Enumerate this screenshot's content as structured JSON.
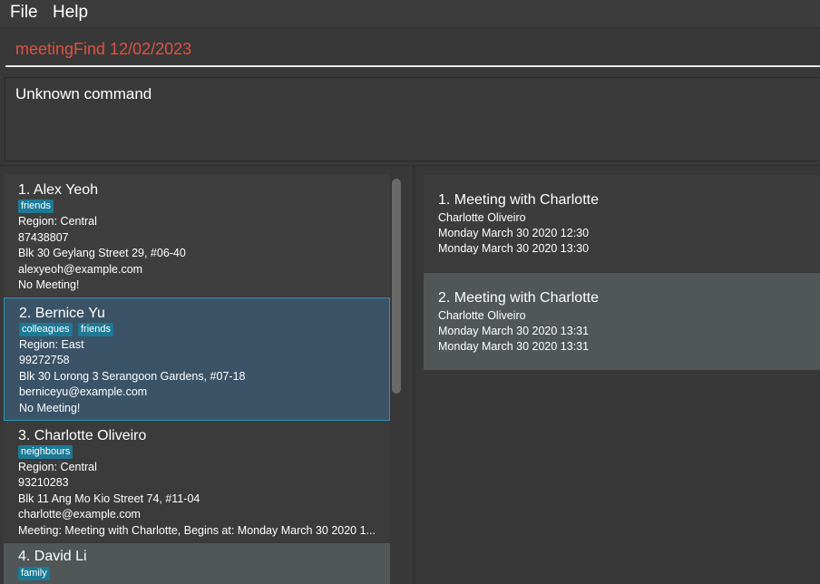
{
  "menu": {
    "file": "File",
    "help": "Help"
  },
  "command": {
    "value": "meetingFind 12/02/2023"
  },
  "result": {
    "text": "Unknown command"
  },
  "persons": [
    {
      "name": "1.  Alex Yeoh",
      "tags": [
        "friends"
      ],
      "region": "Region: Central",
      "phone": "87438807",
      "address": "Blk 30 Geylang Street 29, #06-40",
      "email": "alexyeoh@example.com",
      "meeting": "No Meeting!"
    },
    {
      "name": "2.  Bernice Yu",
      "tags": [
        "colleagues",
        "friends"
      ],
      "region": "Region: East",
      "phone": "99272758",
      "address": "Blk 30 Lorong 3 Serangoon Gardens, #07-18",
      "email": "berniceyu@example.com",
      "meeting": "No Meeting!"
    },
    {
      "name": "3.  Charlotte Oliveiro",
      "tags": [
        "neighbours"
      ],
      "region": "Region: Central",
      "phone": "93210283",
      "address": "Blk 11 Ang Mo Kio Street 74, #11-04",
      "email": "charlotte@example.com",
      "meeting": "Meeting: Meeting with Charlotte, Begins at: Monday March 30 2020 1..."
    },
    {
      "name": "4.  David Li",
      "tags": [
        "family"
      ]
    }
  ],
  "meetings": [
    {
      "title": "1.  Meeting with Charlotte",
      "person": "Charlotte Oliveiro",
      "start": "Monday March 30 2020 12:30",
      "end": "Monday March 30 2020 13:30"
    },
    {
      "title": "2.  Meeting with Charlotte",
      "person": "Charlotte Oliveiro",
      "start": "Monday March 30 2020 13:31",
      "end": "Monday March 30 2020 13:31"
    }
  ]
}
